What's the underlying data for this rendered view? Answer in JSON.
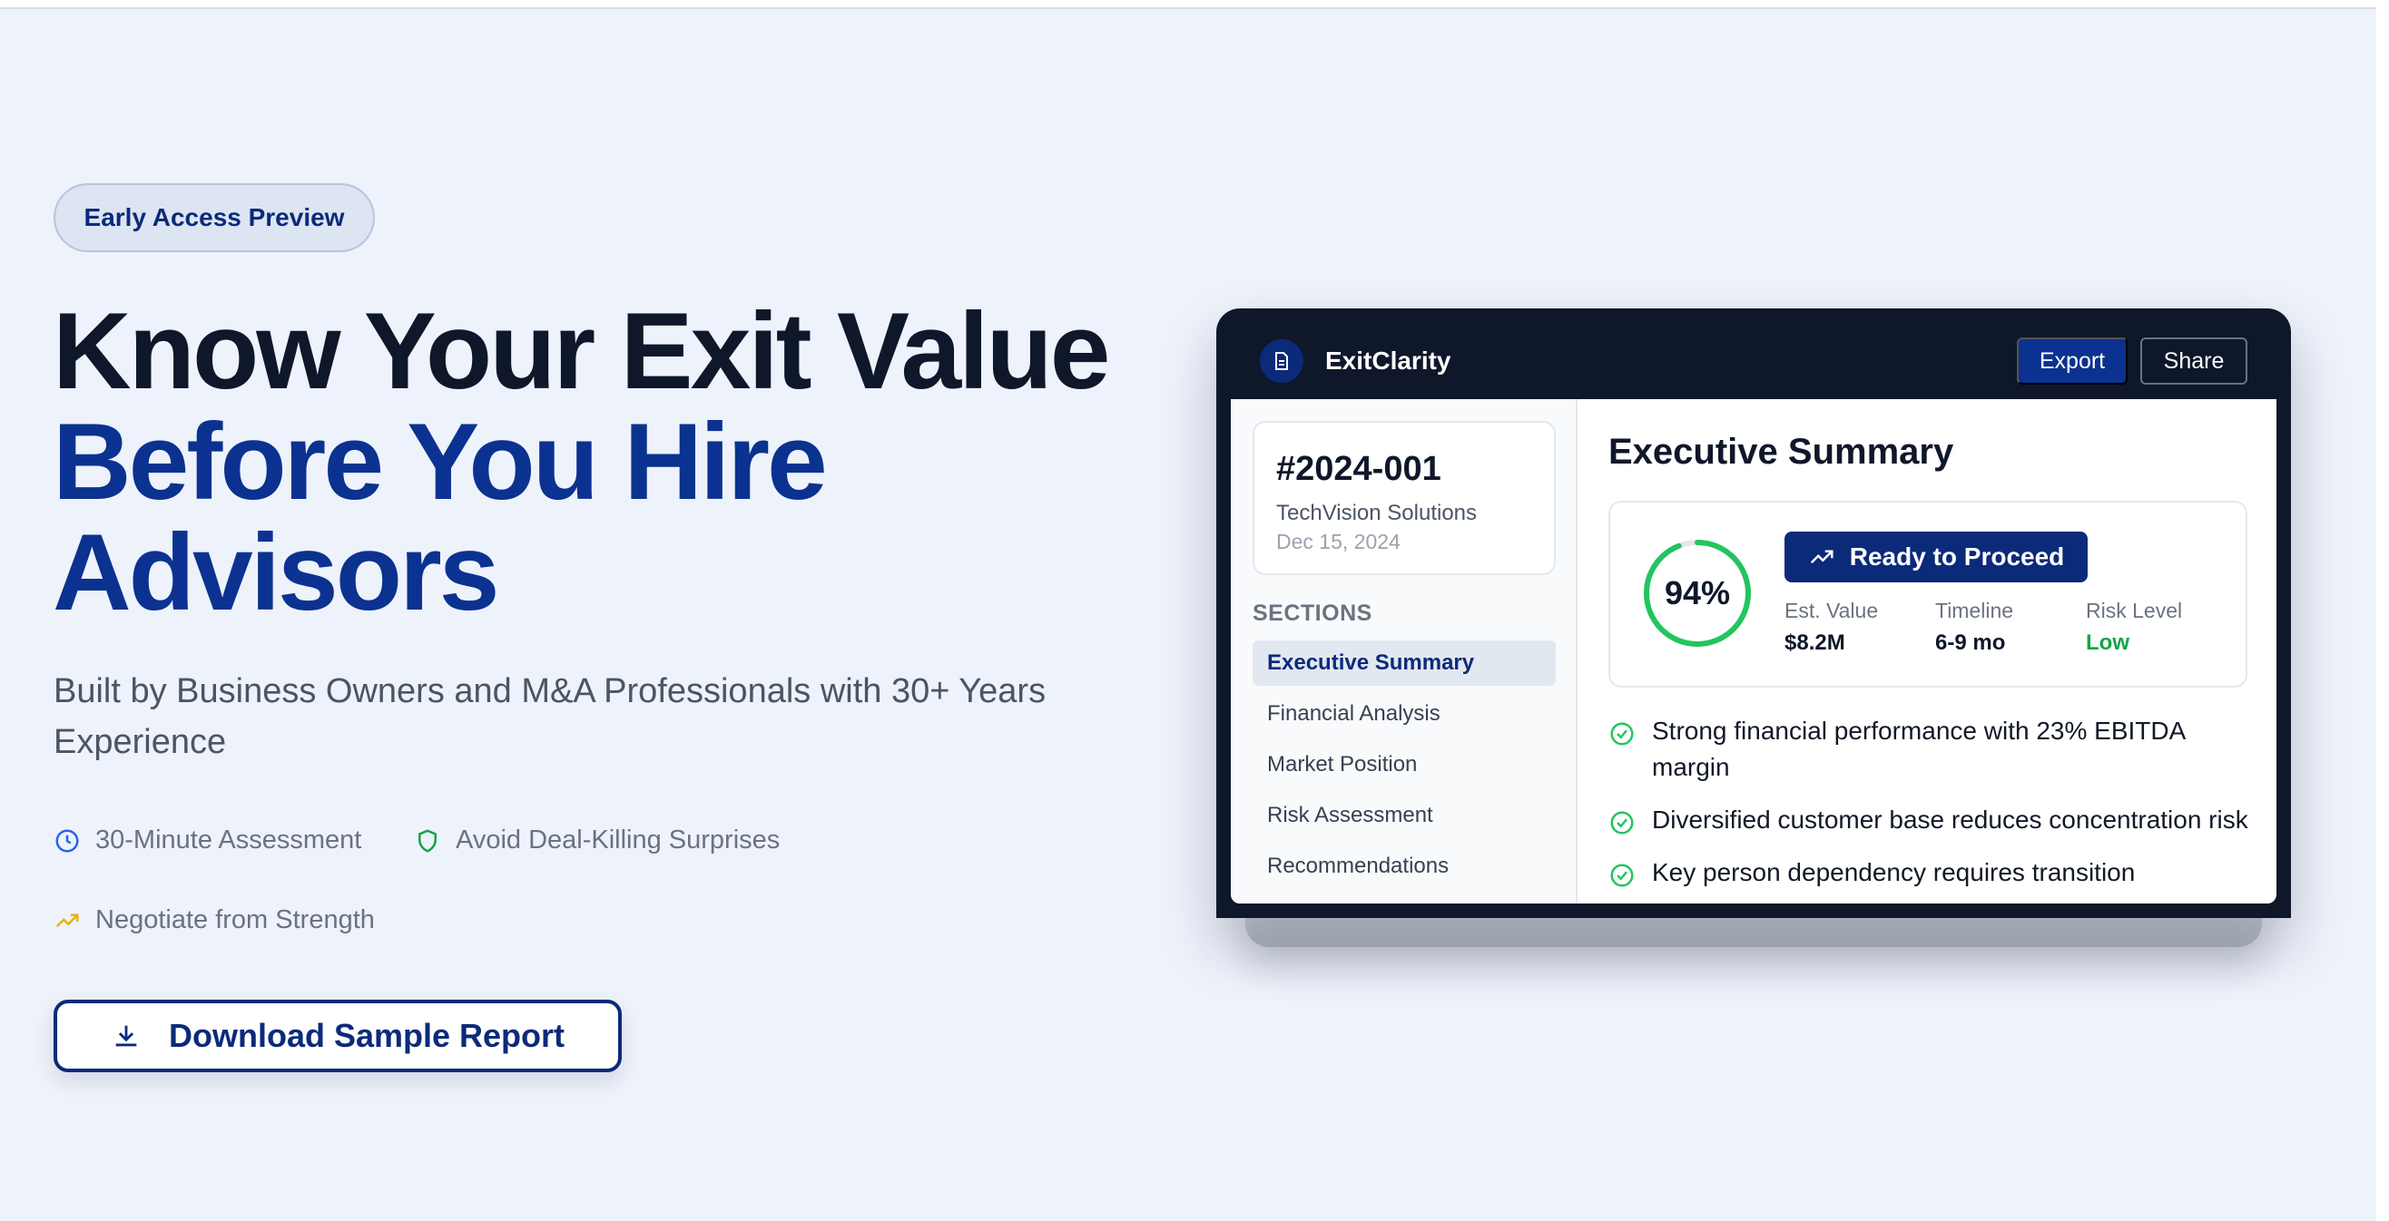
{
  "hero": {
    "badge": "Early Access Preview",
    "headline_line1": "Know Your Exit Value",
    "headline_line2": "Before You Hire",
    "headline_line3": "Advisors",
    "subtitle": "Built by Business Owners and M&A Professionals with 30+ Years Experience",
    "features": [
      {
        "label": "30-Minute Assessment",
        "icon": "clock-icon",
        "color": "#2563eb"
      },
      {
        "label": "Avoid Deal-Killing Surprises",
        "icon": "shield-icon",
        "color": "#16a34a"
      },
      {
        "label": "Negotiate from Strength",
        "icon": "trending-up-icon",
        "color": "#eab308"
      }
    ],
    "cta_label": "Download Sample Report"
  },
  "preview": {
    "app_name": "ExitClarity",
    "export_label": "Export",
    "share_label": "Share",
    "report": {
      "id": "#2024-001",
      "company": "TechVision Solutions",
      "date": "Dec 15, 2024"
    },
    "sections_heading": "SECTIONS",
    "sections": [
      {
        "label": "Executive Summary",
        "active": true
      },
      {
        "label": "Financial Analysis",
        "active": false
      },
      {
        "label": "Market Position",
        "active": false
      },
      {
        "label": "Risk Assessment",
        "active": false
      },
      {
        "label": "Recommendations",
        "active": false
      }
    ],
    "title": "Executive Summary",
    "score": {
      "value": 0.94,
      "label": "94%"
    },
    "status": "Ready to Proceed",
    "metrics": [
      {
        "label": "Est. Value",
        "value": "$8.2M"
      },
      {
        "label": "Timeline",
        "value": "6-9 mo"
      },
      {
        "label": "Risk Level",
        "value": "Low"
      }
    ],
    "findings": [
      "Strong financial performance with 23% EBITDA margin",
      "Diversified customer base reduces concentration risk",
      "Key person dependency requires transition"
    ]
  },
  "colors": {
    "brand_navy": "#0b2a7a",
    "headline_blue": "#0b3290",
    "success_green": "#22c55e"
  }
}
